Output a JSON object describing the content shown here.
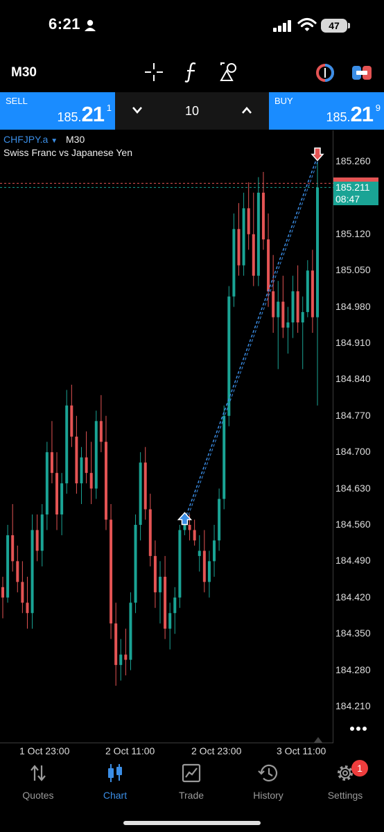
{
  "status_bar": {
    "time": "6:21",
    "battery": "47"
  },
  "toolbar": {
    "timeframe": "M30"
  },
  "trade_panel": {
    "sell": {
      "label": "SELL",
      "price_small": "185.",
      "price_big": "21",
      "price_sup": "1"
    },
    "buy": {
      "label": "BUY",
      "price_small": "185.",
      "price_big": "21",
      "price_sup": "9"
    },
    "lot": "10"
  },
  "chart": {
    "symbol": "CHFJPY.a",
    "timeframe": "M30",
    "description": "Swiss Franc vs Japanese Yen",
    "current_price": "185.211",
    "countdown": "08:47",
    "colors": {
      "bull": "#1aa495",
      "bear": "#e45454",
      "trade_line": "#3b8ee6"
    }
  },
  "chart_data": {
    "type": "candlestick",
    "ylim": [
      184.17,
      185.3
    ],
    "y_ticks": [
      "185.260",
      "185.120",
      "185.050",
      "184.980",
      "184.910",
      "184.840",
      "184.770",
      "184.700",
      "184.630",
      "184.560",
      "184.490",
      "184.420",
      "184.350",
      "184.280",
      "184.210"
    ],
    "x_ticks": [
      "1 Oct 23:00",
      "2 Oct 11:00",
      "2 Oct 23:00",
      "3 Oct 11:00"
    ],
    "trade": {
      "entry_price": 184.57,
      "exit_price": 185.27,
      "direction": "buy"
    },
    "candles": [
      [
        184.44,
        184.46,
        184.38,
        184.42
      ],
      [
        184.42,
        184.56,
        184.41,
        184.54
      ],
      [
        184.54,
        184.6,
        184.47,
        184.49
      ],
      [
        184.49,
        184.52,
        184.43,
        184.45
      ],
      [
        184.45,
        184.49,
        184.39,
        184.41
      ],
      [
        184.41,
        184.46,
        184.36,
        184.39
      ],
      [
        184.39,
        184.58,
        184.36,
        184.55
      ],
      [
        184.55,
        184.58,
        184.49,
        184.51
      ],
      [
        184.51,
        184.6,
        184.48,
        184.58
      ],
      [
        184.58,
        184.72,
        184.55,
        184.7
      ],
      [
        184.7,
        184.76,
        184.64,
        184.66
      ],
      [
        184.66,
        184.7,
        184.55,
        184.58
      ],
      [
        184.58,
        184.66,
        184.54,
        184.64
      ],
      [
        184.64,
        184.82,
        184.62,
        184.79
      ],
      [
        184.79,
        184.83,
        184.71,
        184.73
      ],
      [
        184.73,
        184.77,
        184.62,
        184.64
      ],
      [
        184.64,
        184.71,
        184.6,
        184.69
      ],
      [
        184.69,
        184.74,
        184.64,
        184.66
      ],
      [
        184.66,
        184.72,
        184.6,
        184.63
      ],
      [
        184.63,
        184.78,
        184.61,
        184.76
      ],
      [
        184.76,
        184.81,
        184.7,
        184.72
      ],
      [
        184.72,
        184.77,
        184.55,
        184.57
      ],
      [
        184.57,
        184.6,
        184.34,
        184.37
      ],
      [
        184.37,
        184.41,
        184.25,
        184.29
      ],
      [
        184.29,
        184.34,
        184.26,
        184.31
      ],
      [
        184.31,
        184.36,
        184.27,
        184.3
      ],
      [
        184.3,
        184.43,
        184.28,
        184.41
      ],
      [
        184.41,
        184.58,
        184.39,
        184.56
      ],
      [
        184.56,
        184.7,
        184.53,
        184.68
      ],
      [
        184.68,
        184.71,
        184.57,
        184.59
      ],
      [
        184.59,
        184.62,
        184.48,
        184.5
      ],
      [
        184.5,
        184.53,
        184.4,
        184.43
      ],
      [
        184.43,
        184.49,
        184.37,
        184.46
      ],
      [
        184.46,
        184.5,
        184.34,
        184.36
      ],
      [
        184.36,
        184.41,
        184.32,
        184.39
      ],
      [
        184.39,
        184.44,
        184.35,
        184.42
      ],
      [
        184.42,
        184.56,
        184.4,
        184.55
      ],
      [
        184.55,
        184.58,
        184.54,
        184.56
      ],
      [
        184.56,
        184.58,
        184.53,
        184.55
      ],
      [
        184.55,
        184.57,
        184.52,
        184.53
      ],
      [
        184.5,
        184.54,
        184.47,
        184.51
      ],
      [
        184.51,
        184.55,
        184.43,
        184.45
      ],
      [
        184.45,
        184.51,
        184.42,
        184.49
      ],
      [
        184.49,
        184.56,
        184.46,
        184.53
      ],
      [
        184.53,
        184.63,
        184.51,
        184.61
      ],
      [
        184.61,
        184.79,
        184.59,
        184.77
      ],
      [
        184.77,
        185.02,
        184.75,
        185.0
      ],
      [
        185.0,
        185.16,
        184.98,
        185.13
      ],
      [
        185.13,
        185.18,
        185.04,
        185.06
      ],
      [
        185.06,
        185.2,
        185.04,
        185.17
      ],
      [
        185.17,
        185.22,
        185.09,
        185.12
      ],
      [
        185.12,
        185.2,
        185.02,
        185.04
      ],
      [
        185.04,
        185.23,
        185.02,
        185.2
      ],
      [
        185.2,
        185.24,
        185.09,
        185.11
      ],
      [
        185.11,
        185.16,
        184.98,
        185.01
      ],
      [
        185.01,
        185.08,
        184.93,
        184.96
      ],
      [
        184.96,
        185.03,
        184.86,
        184.99
      ],
      [
        184.99,
        185.04,
        184.92,
        184.94
      ],
      [
        184.94,
        184.98,
        184.89,
        184.95
      ],
      [
        184.95,
        185.04,
        184.92,
        185.01
      ],
      [
        185.01,
        185.06,
        184.93,
        184.95
      ],
      [
        184.95,
        185.0,
        184.86,
        184.97
      ],
      [
        184.97,
        185.07,
        184.96,
        185.05
      ],
      [
        185.05,
        185.09,
        184.93,
        184.96
      ],
      [
        184.96,
        185.26,
        184.79,
        185.21
      ]
    ]
  },
  "nav": [
    {
      "label": "Quotes",
      "icon": "quotes-icon"
    },
    {
      "label": "Chart",
      "icon": "chart-icon"
    },
    {
      "label": "Trade",
      "icon": "trade-icon"
    },
    {
      "label": "History",
      "icon": "history-icon"
    },
    {
      "label": "Settings",
      "icon": "settings-icon"
    }
  ],
  "settings_badge": "1"
}
